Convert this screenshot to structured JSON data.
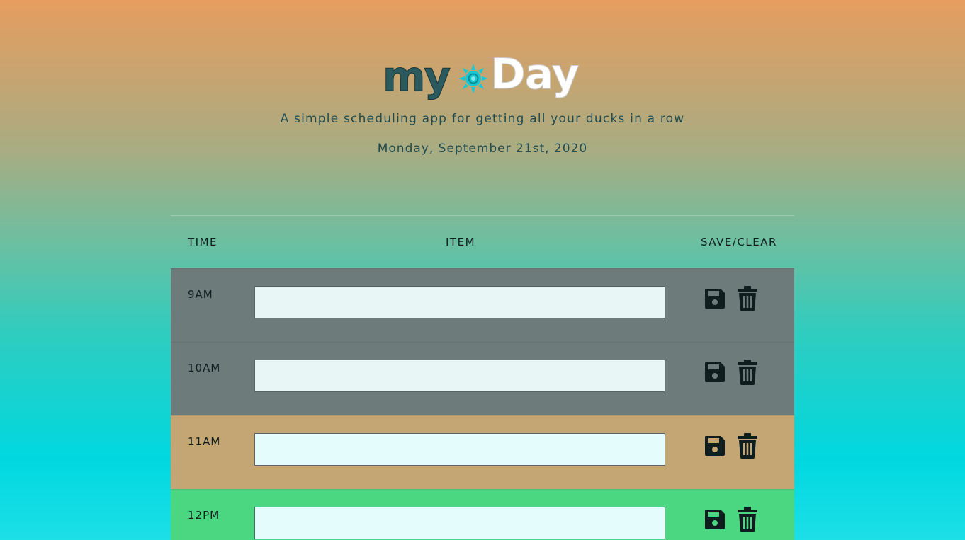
{
  "header": {
    "logo_my": "my",
    "logo_day": "Day",
    "subtitle": "A simple scheduling app for getting all your ducks in a row",
    "date": "Monday, September 21st, 2020"
  },
  "table": {
    "col_time": "TIME",
    "col_item": "ITEM",
    "col_save": "SAVE/CLEAR",
    "rows": [
      {
        "time": "9AM",
        "value": "",
        "status": "past"
      },
      {
        "time": "10AM",
        "value": "",
        "status": "past"
      },
      {
        "time": "11AM",
        "value": "",
        "status": "present"
      },
      {
        "time": "12PM",
        "value": "",
        "status": "future"
      }
    ]
  },
  "icons": {
    "save": "floppy-disk-icon",
    "clear": "trash-can-icon",
    "logo_sun": "sun-icon"
  },
  "colors": {
    "past": "#6e7b7b",
    "present": "#c3a674",
    "future": "#4bd682",
    "sun": "#16c8d4"
  }
}
